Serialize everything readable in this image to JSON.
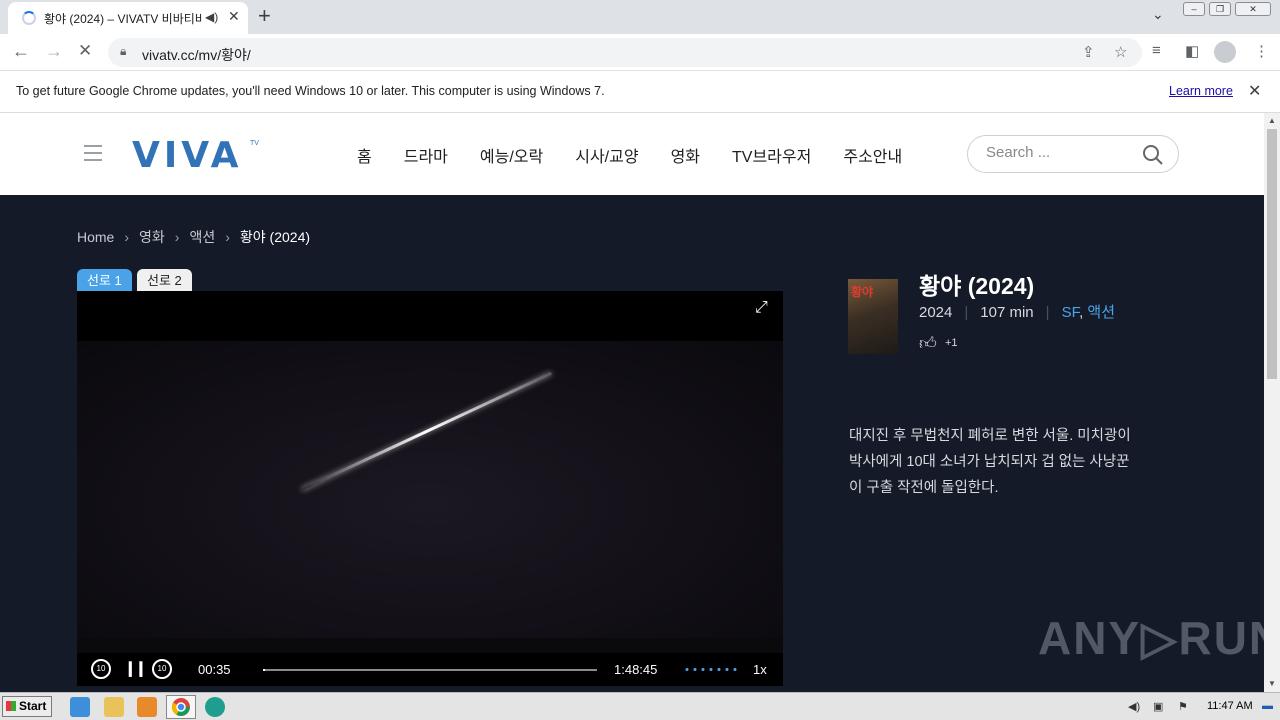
{
  "browser": {
    "tab_title": "황야 (2024) – VIVATV 비바티비",
    "tab_audio_icon": "speaker-icon",
    "tab_close": "✕",
    "new_tab": "+",
    "url": "vivatv.cc/mv/황야/",
    "infobar_text": "To get future Google Chrome updates, you'll need Windows 10 or later. This computer is using Windows 7.",
    "infobar_link": "Learn more"
  },
  "site": {
    "logo": "VIVA",
    "logo_tv": "TV",
    "nav": [
      "홈",
      "드라마",
      "예능/오락",
      "시사/교양",
      "영화",
      "TV브라우저",
      "주소안내"
    ],
    "search_placeholder": "Search ..."
  },
  "breadcrumb": [
    "Home",
    "영화",
    "액션",
    "황야 (2024)"
  ],
  "servers": [
    "선로 1",
    "선로 2"
  ],
  "player": {
    "current_time": "00:35",
    "total_time": "1:48:45",
    "speed": "1x",
    "rewind_label": "10",
    "forward_label": "10",
    "progress": 0.005
  },
  "movie": {
    "title": "황야 (2024)",
    "poster_text": "황야",
    "year": "2024",
    "runtime": "107 min",
    "genres": [
      "SF",
      "액션"
    ],
    "genre_sep": ", ",
    "likes": "+1",
    "synopsis": "대지진 후 무법천지 폐허로 변한 서울. 미치광이 박사에게 10대 소녀가 납치되자 겁 없는 사냥꾼이 구출 작전에 돌입한다."
  },
  "watermark": "ANY▷RUN",
  "taskbar": {
    "start": "Start",
    "clock": "11:47 AM"
  },
  "colors": {
    "accent": "#4aa3e8",
    "dark_bg": "#151a28",
    "logo": "#3273b8"
  }
}
